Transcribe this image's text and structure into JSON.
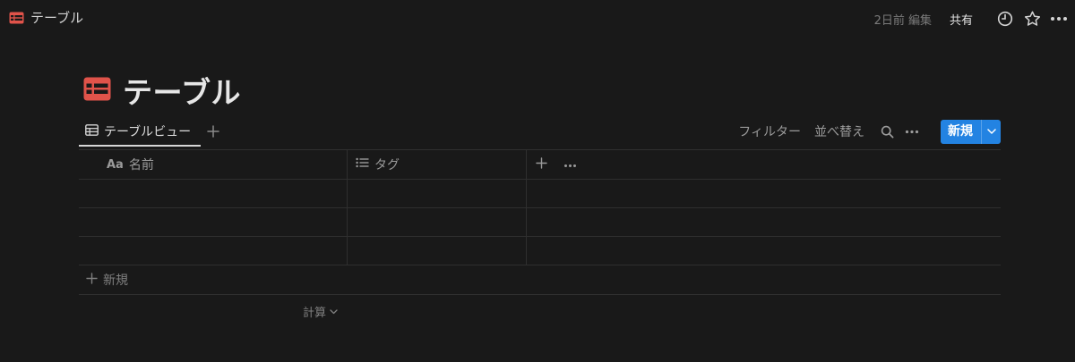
{
  "topbar": {
    "breadcrumb": "テーブル",
    "edited": "2日前 編集",
    "share_label": "共有",
    "icons": [
      "clock-icon",
      "star-icon",
      "more-icon"
    ]
  },
  "page": {
    "title": "テーブル",
    "icon": "table-icon",
    "icon_color": "#e0534a"
  },
  "views": {
    "tabs": [
      {
        "label": "テーブルビュー",
        "icon": "table-icon"
      }
    ],
    "add_icon": "plus-icon"
  },
  "view_actions": {
    "filter_label": "フィルター",
    "sort_label": "並べ替え",
    "new_label": "新規",
    "accent_color": "#2383e2"
  },
  "table": {
    "columns": [
      {
        "label": "名前",
        "type_icon": "Aa"
      },
      {
        "label": "タグ",
        "type_icon": "list-icon"
      }
    ],
    "rows": [
      {
        "name": "",
        "tags": ""
      },
      {
        "name": "",
        "tags": ""
      },
      {
        "name": "",
        "tags": ""
      }
    ],
    "new_row_label": "新規",
    "calc_label": "計算"
  }
}
